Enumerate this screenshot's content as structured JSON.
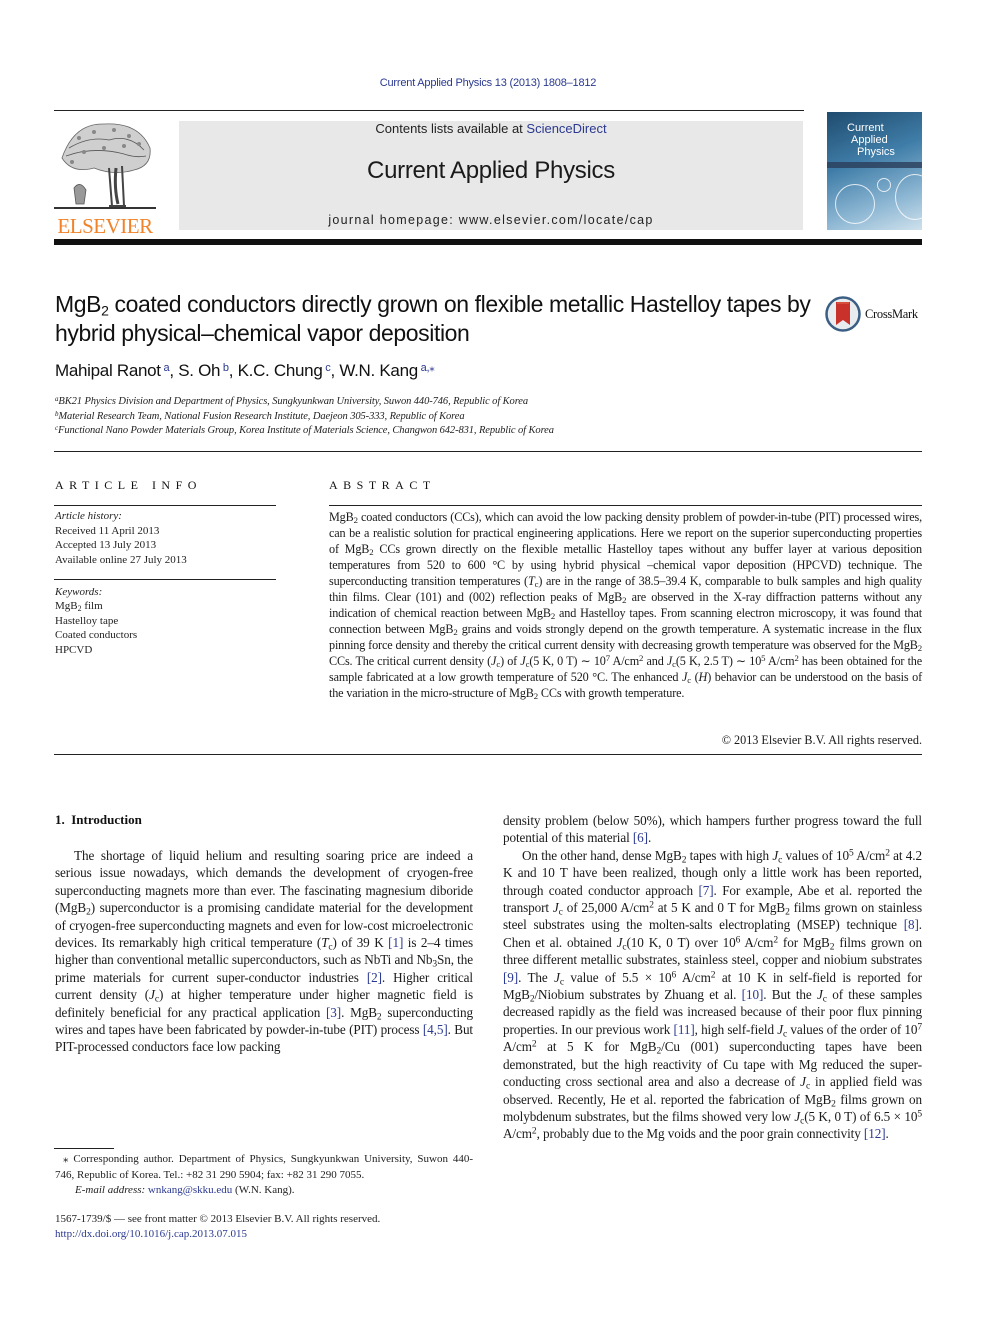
{
  "header": {
    "journal_citation": "Current Applied Physics 13 (2013) 1808–1812",
    "contents_prefix": "Contents lists available at ",
    "contents_link": "ScienceDirect",
    "journal_name": "Current Applied Physics",
    "homepage": "journal homepage: www.elsevier.com/locate/cap",
    "publisher_wordmark": "ELSEVIER",
    "cover": {
      "title_lines": [
        "Current",
        "Applied",
        "Physics"
      ]
    },
    "colors": {
      "link": "#2b3990",
      "elsevier_orange": "#f0832a",
      "banner_bg": "#e8e8e8"
    }
  },
  "article": {
    "title_pre": "MgB",
    "title_sub": "2",
    "title_post": " coated conductors directly grown on flexible metallic Hastelloy tapes by hybrid physical–chemical vapor deposition",
    "crossmark_label": "CrossMark",
    "authors": [
      {
        "name": "Mahipal Ranot",
        "sup": "a"
      },
      {
        "name": "S. Oh",
        "sup": "b"
      },
      {
        "name": "K.C. Chung",
        "sup": "c"
      },
      {
        "name": "W.N. Kang",
        "sup": "a,⁎"
      }
    ],
    "affiliations": [
      {
        "sup": "a",
        "text": "BK21 Physics Division and Department of Physics, Sungkyunkwan University, Suwon 440-746, Republic of Korea"
      },
      {
        "sup": "b",
        "text": "Material Research Team, National Fusion Research Institute, Daejeon 305-333, Republic of Korea"
      },
      {
        "sup": "c",
        "text": "Functional Nano Powder Materials Group, Korea Institute of Materials Science, Changwon 642-831, Republic of Korea"
      }
    ]
  },
  "article_info": {
    "heading": "ARTICLE INFO",
    "history_label": "Article history:",
    "received": "Received 11 April 2013",
    "accepted": "Accepted 13 July 2013",
    "online": "Available online 27 July 2013",
    "keywords_label": "Keywords:",
    "keywords": [
      "MgB2 film",
      "Hastelloy tape",
      "Coated conductors",
      "HPCVD"
    ]
  },
  "abstract": {
    "heading": "ABSTRACT",
    "copyright": "© 2013 Elsevier B.V. All rights reserved."
  },
  "intro": {
    "heading": "1.  Introduction"
  },
  "footnotes": {
    "corresponding": "⁎ Corresponding author. Department of Physics, Sungkyunkwan University, Suwon 440-746, Republic of Korea. Tel.: +82 31 290 5904; fax: +82 31 290 7055.",
    "email_label": "E-mail address:",
    "email": "wnkang@skku.edu",
    "email_suffix": " (W.N. Kang).",
    "front_matter": "1567-1739/$ — see front matter © 2013 Elsevier B.V. All rights reserved.",
    "doi": "http://dx.doi.org/10.1016/j.cap.2013.07.015"
  }
}
